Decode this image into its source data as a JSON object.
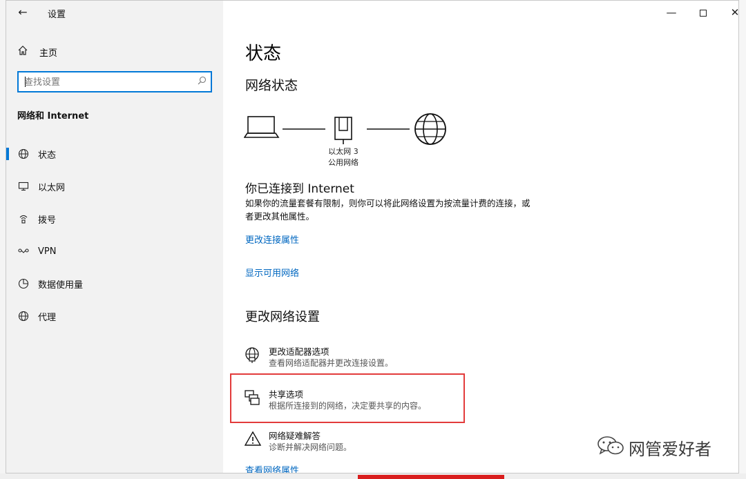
{
  "window": {
    "title": "设置",
    "back_glyph": "←",
    "minimize_glyph": "—",
    "close_glyph": "✕"
  },
  "sidebar": {
    "home_label": "主页",
    "search": {
      "placeholder": "查找设置",
      "value": ""
    },
    "section_title": "网络和 Internet",
    "items": [
      {
        "label": "状态",
        "icon": "globe-icon",
        "active": true
      },
      {
        "label": "以太网",
        "icon": "ethernet-monitor-icon",
        "active": false
      },
      {
        "label": "拨号",
        "icon": "dialup-icon",
        "active": false
      },
      {
        "label": "VPN",
        "icon": "vpn-icon",
        "active": false
      },
      {
        "label": "数据使用量",
        "icon": "data-usage-icon",
        "active": false
      },
      {
        "label": "代理",
        "icon": "globe-icon",
        "active": false
      }
    ]
  },
  "main": {
    "title": "状态",
    "network_status_title": "网络状态",
    "diagram": {
      "adapter_name": "以太网 3",
      "network_type": "公用网络"
    },
    "connected_title": "你已连接到 Internet",
    "connected_desc": "如果你的流量套餐有限制，则你可以将此网络设置为按流量计费的连接，或者更改其他属性。",
    "link_change_props": "更改连接属性",
    "link_show_networks": "显示可用网络",
    "change_settings_title": "更改网络设置",
    "options": [
      {
        "title": "更改适配器选项",
        "desc": "查看网络适配器并更改连接设置。",
        "icon": "adapter-globe-icon"
      },
      {
        "title": "共享选项",
        "desc": "根据所连接到的网络，决定要共享的内容。",
        "icon": "sharing-icon"
      },
      {
        "title": "网络疑难解答",
        "desc": "诊断并解决网络问题。",
        "icon": "warning-icon"
      }
    ],
    "link_view_props": "查看网络属性"
  },
  "watermark": {
    "text": "网管爱好者"
  },
  "colors": {
    "accent": "#0078d7",
    "link": "#0067c0",
    "highlight": "#e23a3a"
  }
}
